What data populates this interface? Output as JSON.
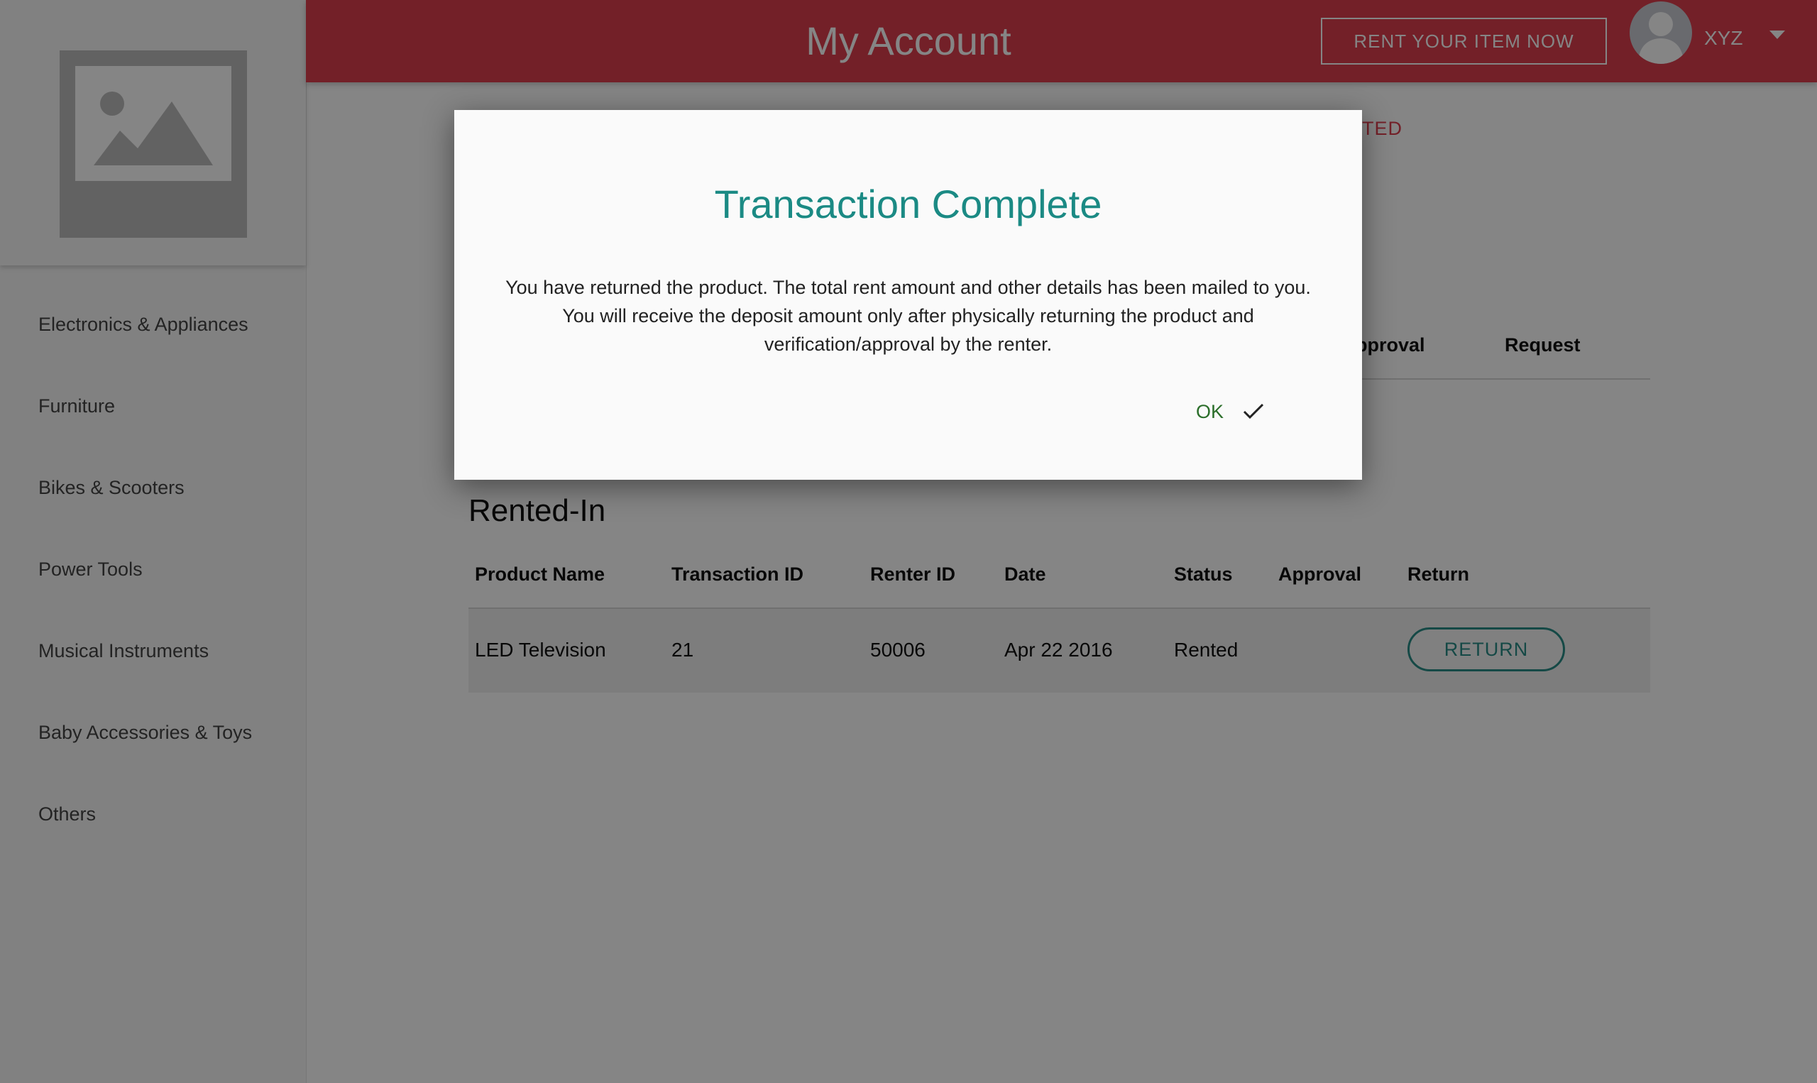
{
  "header": {
    "title": "My Account",
    "rent_button": "RENT YOUR ITEM NOW",
    "username": "XYZ"
  },
  "sidebar": {
    "logo_icon": "image-placeholder-icon",
    "items": [
      {
        "label": "Electronics & Appliances"
      },
      {
        "label": "Furniture"
      },
      {
        "label": "Bikes & Scooters"
      },
      {
        "label": "Power Tools"
      },
      {
        "label": "Musical Instruments"
      },
      {
        "label": "Baby Accessories & Toys"
      },
      {
        "label": "Others"
      }
    ]
  },
  "background": {
    "tab_fragment": "ETED",
    "upper_table_headers": [
      "pproval",
      "Request"
    ]
  },
  "rented_in": {
    "heading": "Rented-In",
    "columns": [
      "Product Name",
      "Transaction ID",
      "Renter ID",
      "Date",
      "Status",
      "Approval",
      "Return"
    ],
    "rows": [
      {
        "product": "LED Television",
        "transaction_id": "21",
        "renter_id": "50006",
        "date": "Apr 22 2016",
        "status": "Rented",
        "approval": "",
        "return_label": "RETURN"
      }
    ]
  },
  "dialog": {
    "title": "Transaction Complete",
    "body_line1": "You have returned the product. The total rent amount and other details has been mailed to you.",
    "body_line2": "You will receive the deposit amount only after physically returning the product and",
    "body_line3": "verification/approval by the renter.",
    "ok_label": "OK",
    "ok_icon": "check-icon"
  },
  "colors": {
    "header": "#dc3e4d",
    "accent_teal": "#1b8a84",
    "ok_green": "#2b6e2a"
  }
}
